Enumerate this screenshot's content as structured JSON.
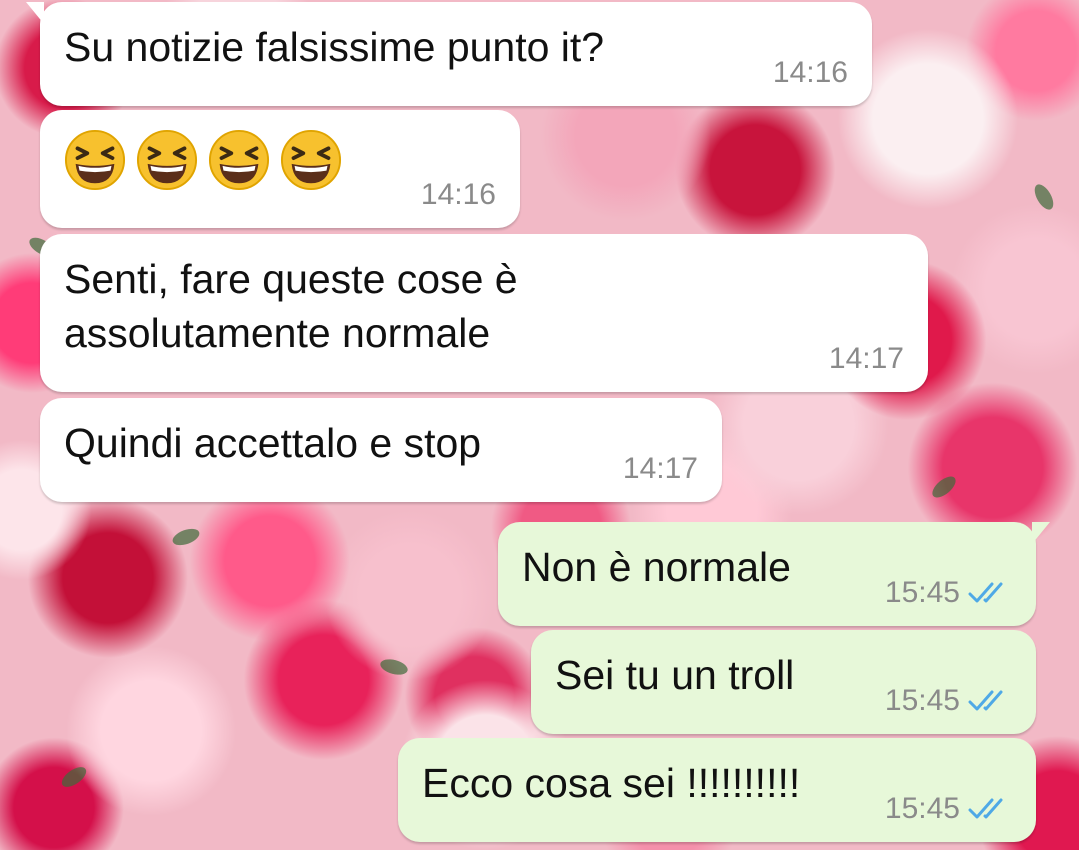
{
  "chat": {
    "messages": [
      {
        "direction": "incoming",
        "text": "Su notizie falsissime punto it?",
        "time": "14:16"
      },
      {
        "direction": "incoming",
        "emoji": [
          "grinning-squinting-face",
          "grinning-squinting-face",
          "grinning-squinting-face",
          "grinning-squinting-face"
        ],
        "time": "14:16"
      },
      {
        "direction": "incoming",
        "text_line1": "Senti, fare queste cose è",
        "text_line2": "assolutamente normale",
        "time": "14:17"
      },
      {
        "direction": "incoming",
        "text": "Quindi accettalo e stop",
        "time": "14:17"
      },
      {
        "direction": "outgoing",
        "text": "Non è normale",
        "time": "15:45",
        "status": "read"
      },
      {
        "direction": "outgoing",
        "text": "Sei tu un troll",
        "time": "15:45",
        "status": "read"
      },
      {
        "direction": "outgoing",
        "text": "Ecco cosa sei !!!!!!!!!!",
        "time": "15:45",
        "status": "read"
      }
    ]
  },
  "colors": {
    "incoming_bubble": "#ffffff",
    "outgoing_bubble": "#e7f8d9",
    "timestamp": "#8a8a8a",
    "read_ticks": "#4fa9e6",
    "emoji_face": "#f7c12e"
  },
  "icons": {
    "read_receipt": "double-check-icon",
    "emoji": "grinning-squinting-face-emoji"
  }
}
